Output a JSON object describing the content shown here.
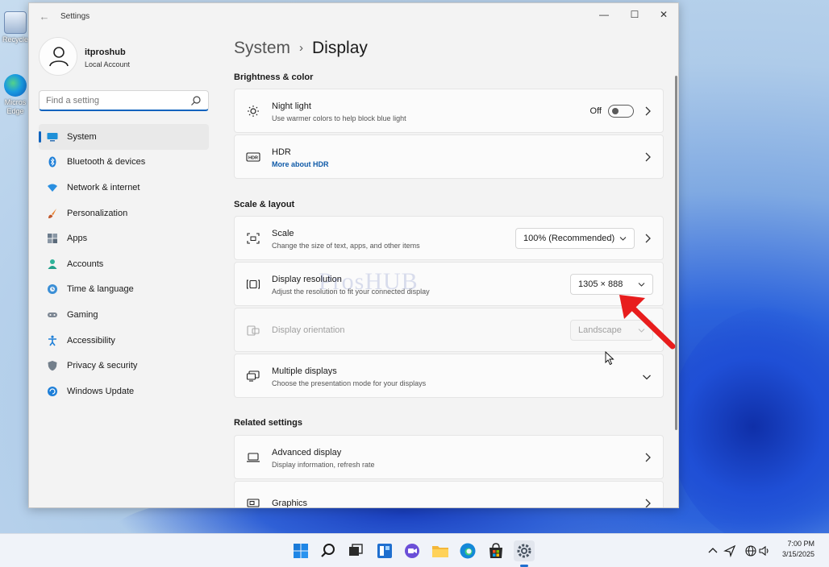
{
  "desktop": {
    "icons": [
      {
        "label": "Recycle"
      },
      {
        "label": "Micros Edge"
      }
    ]
  },
  "window": {
    "title": "Settings",
    "controls": {
      "minimize": "—",
      "maximize": "☐",
      "close": "✕"
    }
  },
  "profile": {
    "name": "itproshub",
    "account_type": "Local Account"
  },
  "search": {
    "placeholder": "Find a setting"
  },
  "sidebar": {
    "items": [
      {
        "label": "System",
        "icon": "monitor-icon",
        "active": true
      },
      {
        "label": "Bluetooth & devices",
        "icon": "bluetooth-icon"
      },
      {
        "label": "Network & internet",
        "icon": "wifi-icon"
      },
      {
        "label": "Personalization",
        "icon": "brush-icon"
      },
      {
        "label": "Apps",
        "icon": "apps-icon"
      },
      {
        "label": "Accounts",
        "icon": "person-icon"
      },
      {
        "label": "Time & language",
        "icon": "globe-clock-icon"
      },
      {
        "label": "Gaming",
        "icon": "gamepad-icon"
      },
      {
        "label": "Accessibility",
        "icon": "accessibility-icon"
      },
      {
        "label": "Privacy & security",
        "icon": "shield-icon"
      },
      {
        "label": "Windows Update",
        "icon": "update-icon"
      }
    ]
  },
  "breadcrumb": {
    "parent": "System",
    "separator": "›",
    "current": "Display"
  },
  "sections": {
    "brightness": "Brightness & color",
    "scale_layout": "Scale & layout",
    "related": "Related settings"
  },
  "cards": {
    "night_light": {
      "title": "Night light",
      "subtitle": "Use warmer colors to help block blue light",
      "toggle_label": "Off"
    },
    "hdr": {
      "title": "HDR",
      "link": "More about HDR"
    },
    "scale": {
      "title": "Scale",
      "subtitle": "Change the size of text, apps, and other items",
      "value": "100% (Recommended)"
    },
    "resolution": {
      "title": "Display resolution",
      "subtitle": "Adjust the resolution to fit your connected display",
      "value": "1305 × 888"
    },
    "orientation": {
      "title": "Display orientation",
      "value": "Landscape"
    },
    "multiple": {
      "title": "Multiple displays",
      "subtitle": "Choose the presentation mode for your displays"
    },
    "advanced": {
      "title": "Advanced display",
      "subtitle": "Display information, refresh rate"
    },
    "graphics": {
      "title": "Graphics"
    }
  },
  "overlay": {
    "watermark": "ProsHUB"
  },
  "taskbar": {
    "time": "7:00 PM",
    "date": "3/15/2025"
  },
  "colors": {
    "accent": "#0f63be",
    "arrow": "#e81d1d"
  }
}
